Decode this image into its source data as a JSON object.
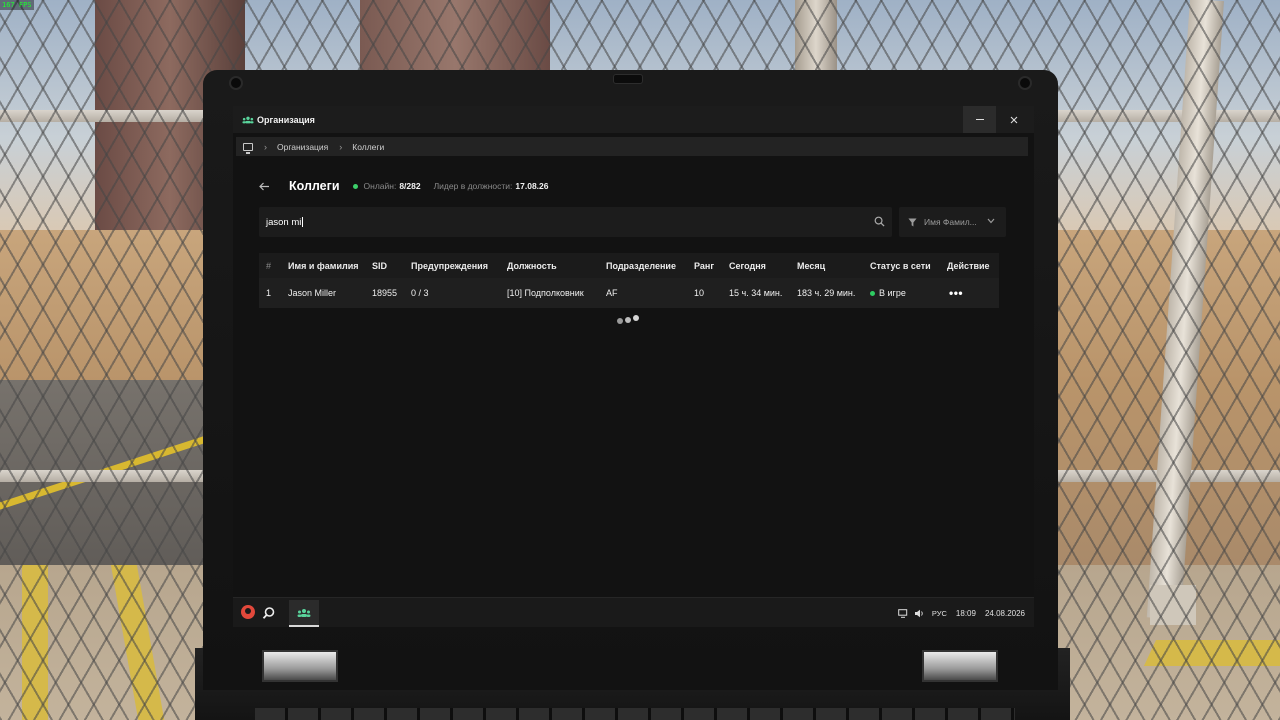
{
  "overlay": {
    "fps": "167 FPS"
  },
  "window": {
    "title": "Организация",
    "minimize_label": "–",
    "close_label": "×"
  },
  "breadcrumb": {
    "items": [
      "Организация",
      "Коллеги"
    ]
  },
  "header": {
    "title": "Коллеги",
    "online_label": "Онлайн:",
    "online_value": "8/282",
    "leader_label": "Лидер в должности:",
    "leader_value": "17.08.26"
  },
  "search": {
    "value": "jason mi",
    "icon": "search-icon"
  },
  "filter": {
    "selected": "Имя Фамил...",
    "icon": "filter-icon"
  },
  "table": {
    "columns": [
      "#",
      "Имя и фамилия",
      "SID",
      "Предупреждения",
      "Должность",
      "Подразделение",
      "Ранг",
      "Сегодня",
      "Месяц",
      "Статус в сети",
      "Действие"
    ],
    "rows": [
      {
        "num": "1",
        "name": "Jason Miller",
        "sid": "18955",
        "warnings": "0 / 3",
        "position": "[10] Подполковник",
        "division": "AF",
        "rank": "10",
        "today": "15 ч. 34 мин.",
        "month": "183 ч. 29 мин.",
        "status": "В игре",
        "status_color": "#2ecc62",
        "action": "•••"
      }
    ]
  },
  "taskbar": {
    "lang": "РУС",
    "time": "18:09",
    "date": "24.08.2026"
  },
  "colors": {
    "accent_green": "#59d39b",
    "online_dot": "#3ccf6a",
    "logo_red": "#e2483b"
  }
}
